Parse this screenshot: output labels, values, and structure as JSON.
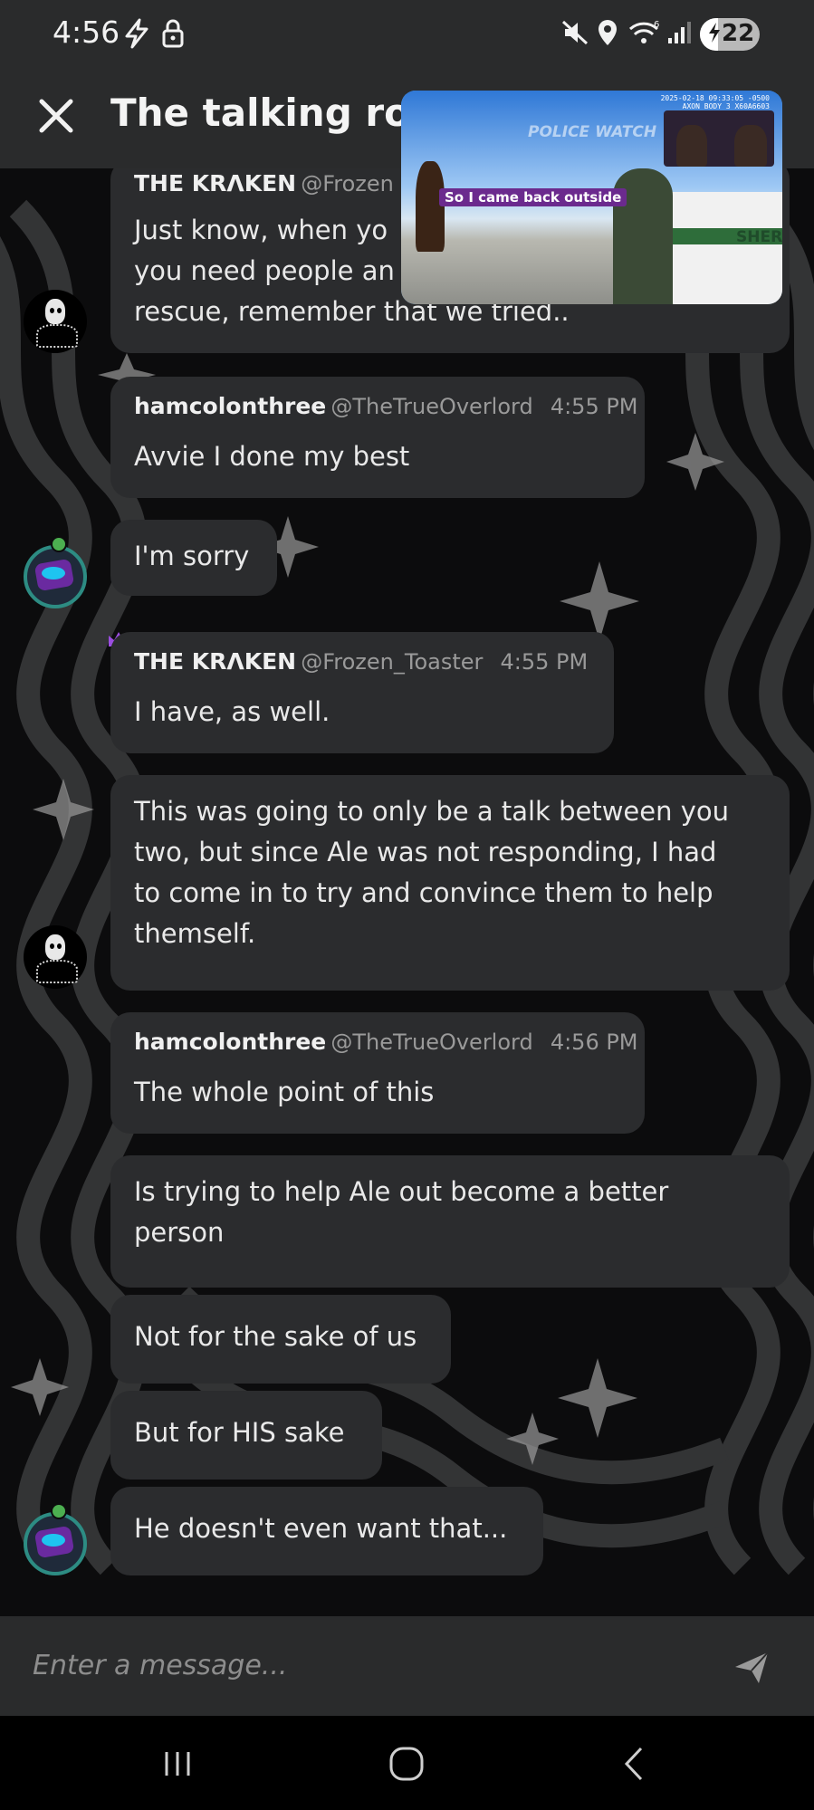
{
  "status_bar": {
    "time": "4:56",
    "battery": "22",
    "icons": [
      "bolt-icon",
      "lock-icon",
      "mute-icon",
      "location-icon",
      "wifi-icon",
      "signal-icon"
    ]
  },
  "header": {
    "title": "The talking room",
    "close_icon": "close-icon"
  },
  "video_overlay": {
    "caption": "So I came back outside",
    "watermark": "POLICE WATCH",
    "meta": "2025-02-18 09:33:05 -0500 AXON BODY 3 X60A6603",
    "car_text": "SHER"
  },
  "messages": [
    {
      "author": "THE KRΛKEN",
      "handle": "@Frozen",
      "text_lines": [
        "Just know, when yo",
        "you need people an",
        "rescue, remember that we tried.."
      ]
    },
    {
      "author": "hamcolonthree",
      "handle": "@TheTrueOverlord",
      "time": "4:55 PM",
      "text": "Avvie I done my best"
    },
    {
      "text": "I'm sorry"
    },
    {
      "author": "THE KRΛKEN",
      "handle": "@Frozen_Toaster",
      "time": "4:55 PM",
      "text": "I have, as well."
    },
    {
      "text_lines": [
        "This was going to only be a talk between you",
        "two, but since Ale was not responding, I had",
        "to come in to try and convince them to help",
        "themself."
      ]
    },
    {
      "author": "hamcolonthree",
      "handle": "@TheTrueOverlord",
      "time": "4:56 PM",
      "text": "The whole point of this"
    },
    {
      "text_lines": [
        "Is trying to help Ale out become a better",
        "person"
      ]
    },
    {
      "text": "Not for the sake of us"
    },
    {
      "text": "But for HIS sake"
    },
    {
      "text": "He doesn't even want that..."
    }
  ],
  "composer": {
    "placeholder": "Enter a message...",
    "send_icon": "send-icon"
  },
  "nav_bar": {
    "buttons": [
      "recents-icon",
      "home-icon",
      "back-icon"
    ]
  },
  "colors": {
    "bubble": "#2b2c2e",
    "bar": "#2a2b2c",
    "background": "#0c0c0d",
    "crown": "#9b4de0"
  }
}
